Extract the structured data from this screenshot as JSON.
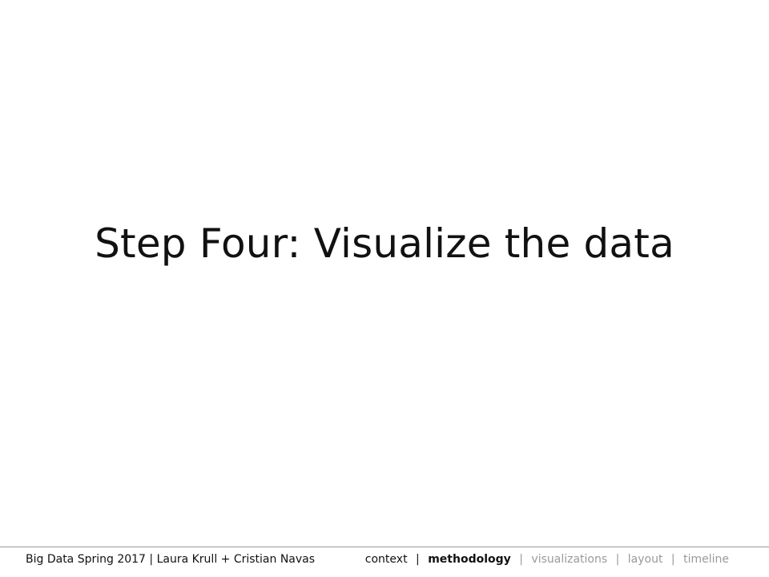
{
  "slide": {
    "title": "Step Four: Visualize the data"
  },
  "footer": {
    "credit": "Big Data Spring 2017 | Laura Krull + Cristian Navas",
    "separator": "|",
    "nav": [
      {
        "label": "context",
        "state": "visited"
      },
      {
        "label": "methodology",
        "state": "current"
      },
      {
        "label": "visualizations",
        "state": "upcoming"
      },
      {
        "label": "layout",
        "state": "upcoming"
      },
      {
        "label": "timeline",
        "state": "upcoming"
      }
    ]
  },
  "colors": {
    "text": "#111111",
    "muted": "#9a9a9a",
    "background": "#ffffff",
    "rule": "#9a9a9a"
  }
}
